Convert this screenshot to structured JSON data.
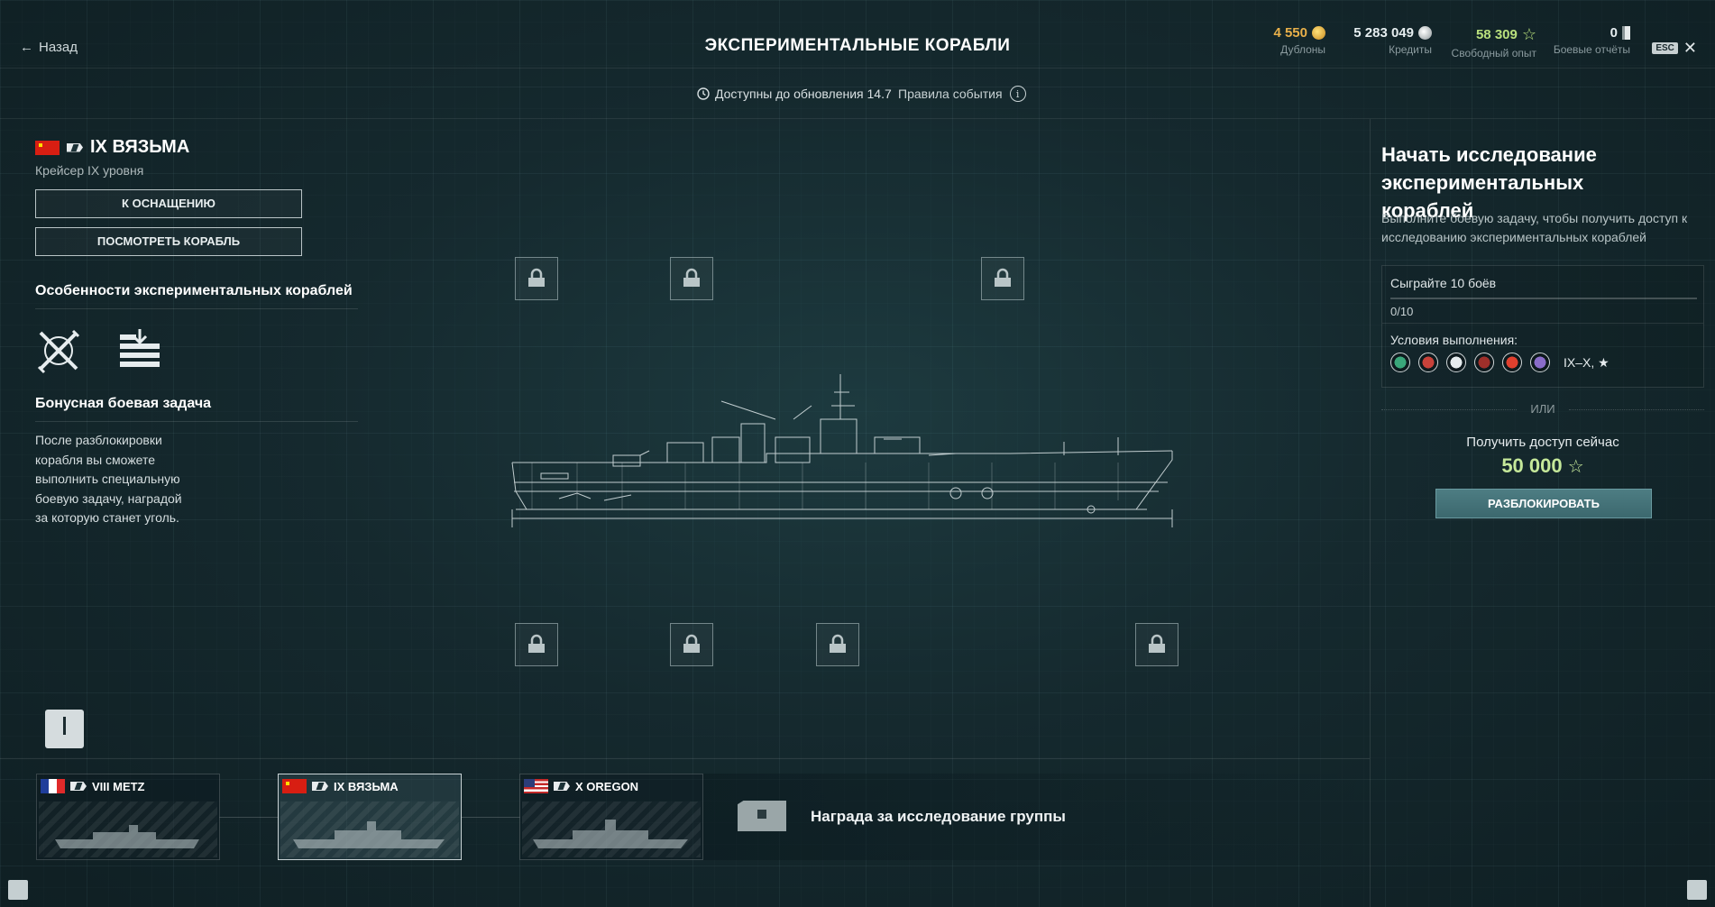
{
  "header": {
    "back_label": "Назад",
    "title": "ЭКСПЕРИМЕНТАЛЬНЫЕ КОРАБЛИ",
    "resources": [
      {
        "value": "4 550",
        "label": "Дублоны",
        "color": "#e8b04a"
      },
      {
        "value": "5 283 049",
        "label": "Кредиты",
        "color": "#e6eaeb"
      },
      {
        "value": "58 309",
        "label": "Свободный опыт",
        "color": "#b9e07d"
      },
      {
        "value": "0",
        "label": "Боевые отчёты",
        "color": "#e6eaeb"
      }
    ],
    "esc_key": "ESC",
    "close_symbol": "✕"
  },
  "subbar": {
    "availability": "Доступны до обновления 14.7",
    "rules_label": "Правила события",
    "info_symbol": "i"
  },
  "ship": {
    "name": "IX ВЯЗЬМА",
    "subtitle": "Крейсер IX уровня",
    "equip_button": "К ОСНАЩЕНИЮ",
    "view_button": "ПОСМОТРЕТЬ КОРАБЛЬ"
  },
  "features": {
    "title": "Особенности экспериментальных кораблей",
    "icons": [
      "crossed-guns-icon",
      "ammo-supply-icon"
    ]
  },
  "bonus": {
    "title": "Бонусная боевая задача",
    "text": "После разблокировки корабля вы сможете выполнить специальную боевую задачу, наградой за которую станет уголь."
  },
  "right_panel": {
    "title": "Начать исследование экспериментальных кораблей",
    "description": "Выполните боевую задачу, чтобы получить доступ к исследованию экспериментальных кораблей",
    "task": "Сыграйте 10 боёв",
    "progress": "0/10",
    "progress_value": 0,
    "conditions_label": "Условия выполнения:",
    "condition_icons": [
      "green",
      "red",
      "white",
      "red-dark",
      "red-bright",
      "purple"
    ],
    "tiers": "IX–X, ★",
    "or_label": "ИЛИ",
    "instant_label": "Получить доступ сейчас",
    "price": "50 000",
    "unlock_button": "РАЗБЛОКИРОВАТЬ"
  },
  "group": {
    "cards": [
      {
        "name": "VIII METZ",
        "flag": "fr"
      },
      {
        "name": "IX ВЯЗЬМА",
        "flag": "cn"
      },
      {
        "name": "X OREGON",
        "flag": "us"
      }
    ],
    "reward_label": "Награда за исследование группы"
  }
}
